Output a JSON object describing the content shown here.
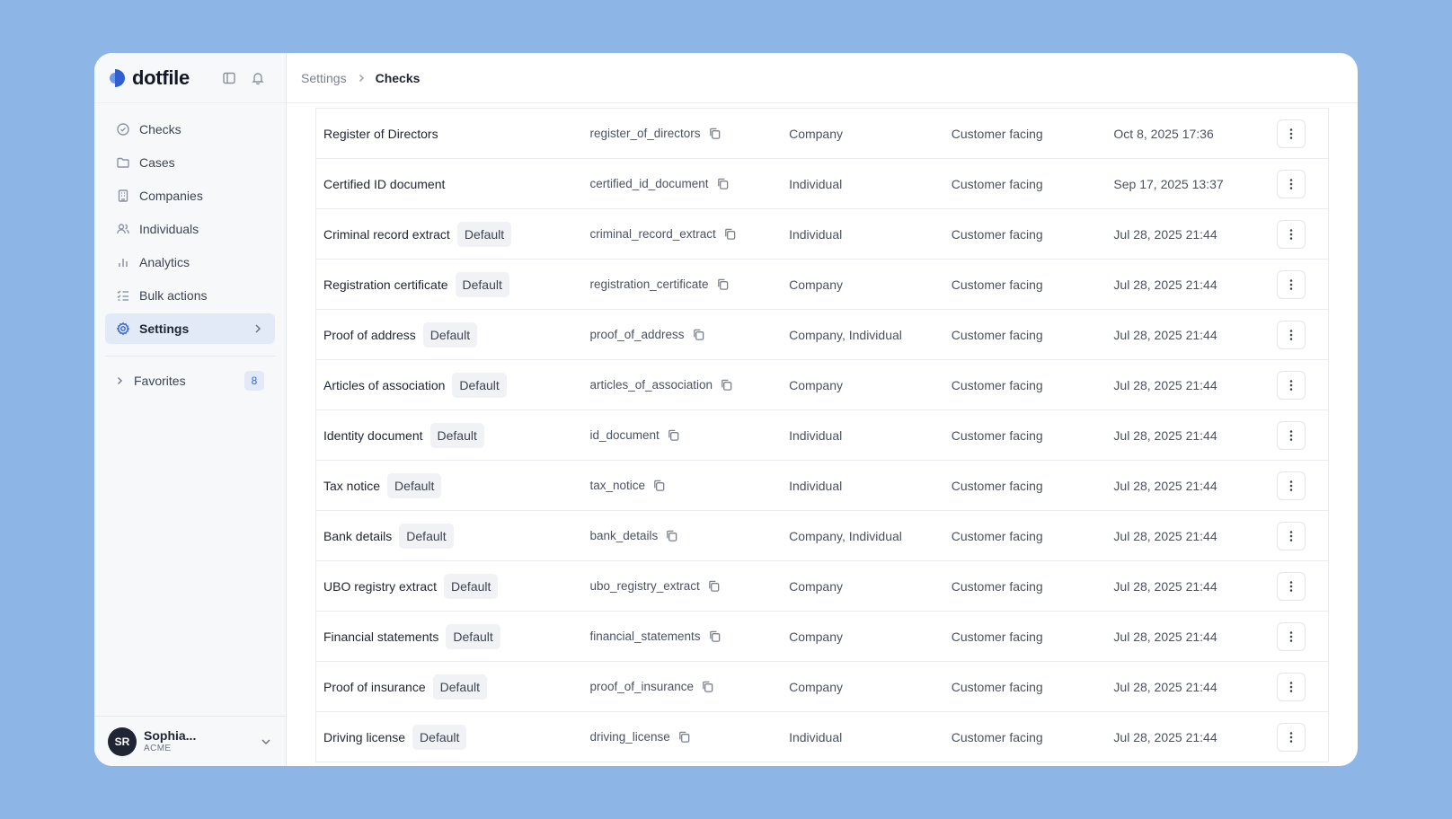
{
  "app": {
    "logo_text": "dotfile"
  },
  "sidebar": {
    "items": [
      {
        "label": "Checks",
        "icon": "check-circle-icon",
        "active": false
      },
      {
        "label": "Cases",
        "icon": "folder-icon",
        "active": false
      },
      {
        "label": "Companies",
        "icon": "building-icon",
        "active": false
      },
      {
        "label": "Individuals",
        "icon": "users-icon",
        "active": false
      },
      {
        "label": "Analytics",
        "icon": "bar-chart-icon",
        "active": false
      },
      {
        "label": "Bulk actions",
        "icon": "list-checks-icon",
        "active": false
      },
      {
        "label": "Settings",
        "icon": "gear-icon",
        "active": true
      }
    ],
    "favorites": {
      "label": "Favorites",
      "count": "8"
    },
    "user": {
      "initials": "SR",
      "name": "Sophia...",
      "org": "ACME"
    }
  },
  "header": {
    "breadcrumb_parent": "Settings",
    "breadcrumb_current": "Checks"
  },
  "colors": {
    "accent": "#3565d6",
    "active_bg": "#e3eaf7",
    "page_bg": "#8db5e6"
  },
  "checks": {
    "rows": [
      {
        "name": "Register of Directors",
        "tag": "",
        "key": "register_of_directors",
        "type": "Company",
        "facing": "Customer facing",
        "date": "Oct 8, 2025 17:36"
      },
      {
        "name": "Certified ID document",
        "tag": "",
        "key": "certified_id_document",
        "type": "Individual",
        "facing": "Customer facing",
        "date": "Sep 17, 2025 13:37"
      },
      {
        "name": "Criminal record extract",
        "tag": "Default",
        "key": "criminal_record_extract",
        "type": "Individual",
        "facing": "Customer facing",
        "date": "Jul 28, 2025 21:44"
      },
      {
        "name": "Registration certificate",
        "tag": "Default",
        "key": "registration_certificate",
        "type": "Company",
        "facing": "Customer facing",
        "date": "Jul 28, 2025 21:44"
      },
      {
        "name": "Proof of address",
        "tag": "Default",
        "key": "proof_of_address",
        "type": "Company, Individual",
        "facing": "Customer facing",
        "date": "Jul 28, 2025 21:44"
      },
      {
        "name": "Articles of association",
        "tag": "Default",
        "key": "articles_of_association",
        "type": "Company",
        "facing": "Customer facing",
        "date": "Jul 28, 2025 21:44"
      },
      {
        "name": "Identity document",
        "tag": "Default",
        "key": "id_document",
        "type": "Individual",
        "facing": "Customer facing",
        "date": "Jul 28, 2025 21:44"
      },
      {
        "name": "Tax notice",
        "tag": "Default",
        "key": "tax_notice",
        "type": "Individual",
        "facing": "Customer facing",
        "date": "Jul 28, 2025 21:44"
      },
      {
        "name": "Bank details",
        "tag": "Default",
        "key": "bank_details",
        "type": "Company, Individual",
        "facing": "Customer facing",
        "date": "Jul 28, 2025 21:44"
      },
      {
        "name": "UBO registry extract",
        "tag": "Default",
        "key": "ubo_registry_extract",
        "type": "Company",
        "facing": "Customer facing",
        "date": "Jul 28, 2025 21:44"
      },
      {
        "name": "Financial statements",
        "tag": "Default",
        "key": "financial_statements",
        "type": "Company",
        "facing": "Customer facing",
        "date": "Jul 28, 2025 21:44"
      },
      {
        "name": "Proof of insurance",
        "tag": "Default",
        "key": "proof_of_insurance",
        "type": "Company",
        "facing": "Customer facing",
        "date": "Jul 28, 2025 21:44"
      },
      {
        "name": "Driving license",
        "tag": "Default",
        "key": "driving_license",
        "type": "Individual",
        "facing": "Customer facing",
        "date": "Jul 28, 2025 21:44"
      }
    ]
  }
}
